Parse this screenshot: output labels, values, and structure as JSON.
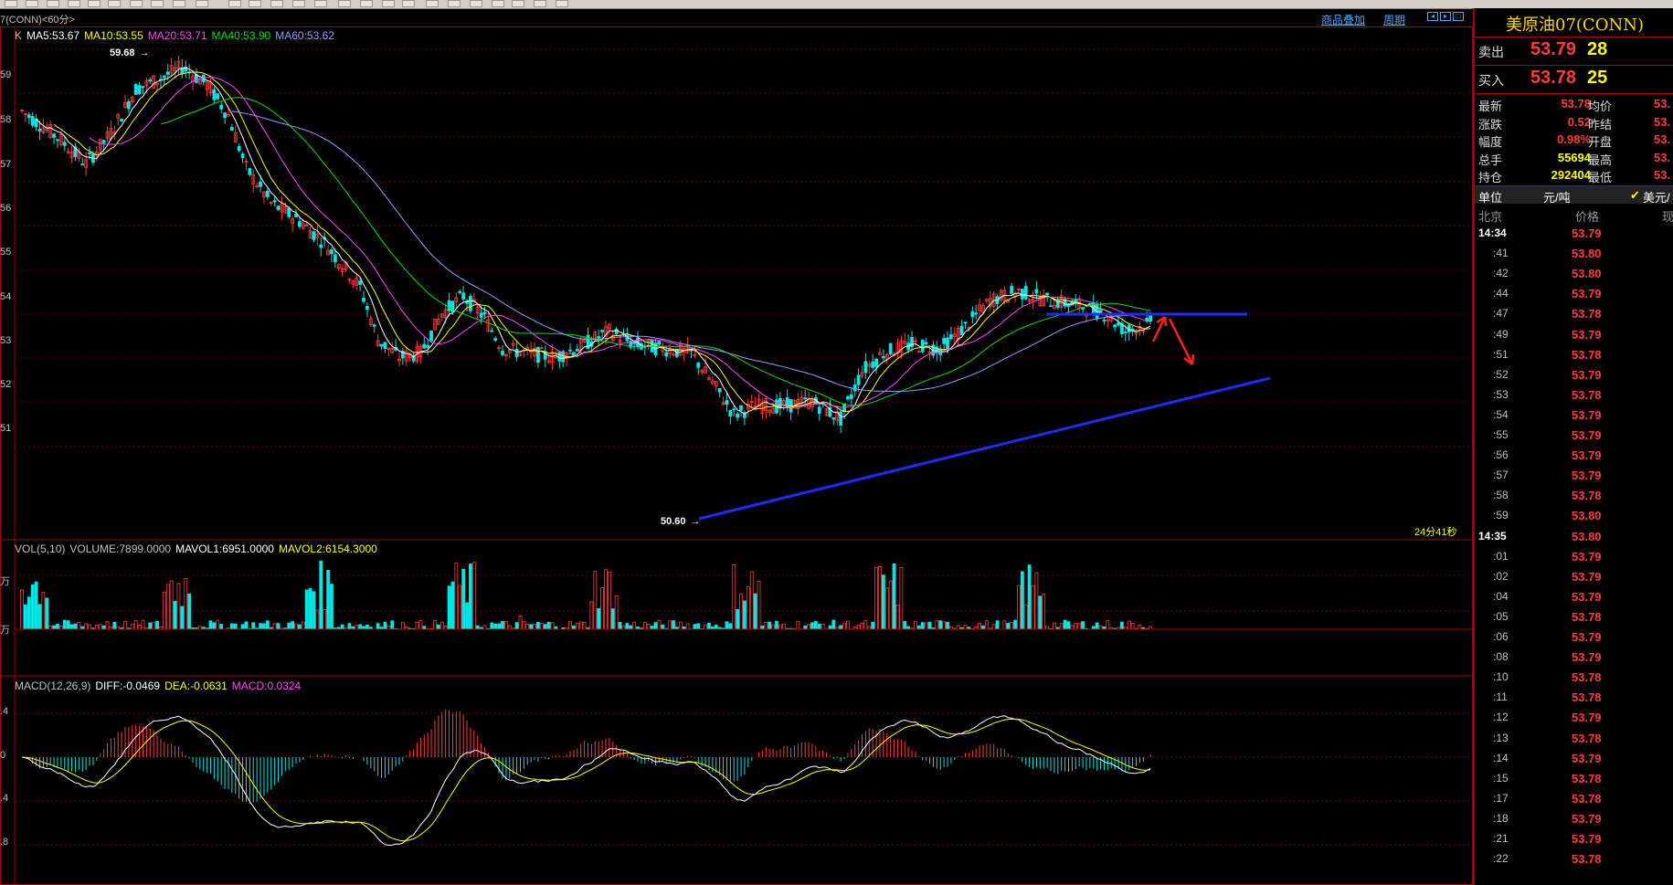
{
  "header": {
    "title": "7(CONN)<60分>",
    "links": [
      "商品叠加",
      "周期"
    ],
    "countdown": "24分41秒"
  },
  "kline": {
    "legend": [
      {
        "text": "K",
        "color": "#c0c0c0"
      },
      {
        "text": "MA5:53.67",
        "color": "#ffffff"
      },
      {
        "text": "MA10:53.55",
        "color": "#ffff00"
      },
      {
        "text": "MA20:53.71",
        "color": "#ff44ff"
      },
      {
        "text": "MA40:53.90",
        "color": "#00e000"
      },
      {
        "text": "MA60:53.62",
        "color": "#9a9aff"
      }
    ],
    "ylabels": [
      "59",
      "58",
      "57",
      "56",
      "55",
      "54",
      "53",
      "52",
      "51"
    ],
    "high_label": "59.68",
    "low_label": "50.60"
  },
  "volume": {
    "legend": [
      {
        "text": "VOL(5,10)",
        "color": "#c0c0c0"
      },
      {
        "text": "VOLUME:7899.0000",
        "color": "#c0c0c0"
      },
      {
        "text": "MAVOL1:6951.0000",
        "color": "#ffffff"
      },
      {
        "text": "MAVOL2:6154.3000",
        "color": "#ffff00"
      }
    ],
    "ylabels": [
      "万",
      "万"
    ]
  },
  "macd": {
    "legend": [
      {
        "text": "MACD(12,26,9)",
        "color": "#c0c0c0"
      },
      {
        "text": "DIFF:-0.0469",
        "color": "#ffffff"
      },
      {
        "text": "DEA:-0.0631",
        "color": "#ffff00"
      },
      {
        "text": "MACD:0.0324",
        "color": "#ff44ff"
      }
    ],
    "ylabels": [
      ".4",
      "0",
      ".4",
      ".8"
    ]
  },
  "quote": {
    "title": "美原油07(CONN)",
    "sell_label": "卖出",
    "sell_price": "53.79",
    "sell_qty": "28",
    "buy_label": "买入",
    "buy_price": "53.78",
    "buy_qty": "25",
    "stats": [
      {
        "l1": "最新",
        "v1": "53.78",
        "c1": "#ff3b3b",
        "l2": "均价",
        "v2": "53."
      },
      {
        "l1": "涨跌",
        "v1": "0.52",
        "c1": "#ff3b3b",
        "l2": "昨结",
        "v2": "53."
      },
      {
        "l1": "幅度",
        "v1": "0.98%",
        "c1": "#ff3b3b",
        "l2": "开盘",
        "v2": "53."
      },
      {
        "l1": "总手",
        "v1": "55694",
        "c1": "#ffff00",
        "l2": "最高",
        "v2": "53."
      },
      {
        "l1": "持仓",
        "v1": "292404",
        "c1": "#ffff00",
        "l2": "最低",
        "v2": "53."
      }
    ],
    "unit_label": "单位",
    "unit_value": "元/吨",
    "currency": "美元/",
    "col_time": "北京",
    "col_price": "价格",
    "col_qty": "现",
    "ticks": [
      {
        "t": "14:34",
        "p": "53.79",
        "bold": true
      },
      {
        "t": ":41",
        "p": "53.80"
      },
      {
        "t": ":42",
        "p": "53.80"
      },
      {
        "t": ":44",
        "p": "53.79"
      },
      {
        "t": ":47",
        "p": "53.78"
      },
      {
        "t": ":49",
        "p": "53.79"
      },
      {
        "t": ":51",
        "p": "53.78"
      },
      {
        "t": ":52",
        "p": "53.79"
      },
      {
        "t": ":53",
        "p": "53.78"
      },
      {
        "t": ":54",
        "p": "53.79"
      },
      {
        "t": ":55",
        "p": "53.79"
      },
      {
        "t": ":56",
        "p": "53.79"
      },
      {
        "t": ":57",
        "p": "53.79"
      },
      {
        "t": ":58",
        "p": "53.78"
      },
      {
        "t": ":59",
        "p": "53.80"
      },
      {
        "t": "14:35",
        "p": "53.80",
        "bold": true
      },
      {
        "t": ":01",
        "p": "53.79"
      },
      {
        "t": ":02",
        "p": "53.79"
      },
      {
        "t": ":04",
        "p": "53.79"
      },
      {
        "t": ":05",
        "p": "53.78"
      },
      {
        "t": ":06",
        "p": "53.79"
      },
      {
        "t": ":08",
        "p": "53.79"
      },
      {
        "t": ":10",
        "p": "53.78"
      },
      {
        "t": ":11",
        "p": "53.78"
      },
      {
        "t": ":12",
        "p": "53.79"
      },
      {
        "t": ":13",
        "p": "53.78"
      },
      {
        "t": ":14",
        "p": "53.79"
      },
      {
        "t": ":15",
        "p": "53.78"
      },
      {
        "t": ":17",
        "p": "53.78"
      },
      {
        "t": ":18",
        "p": "53.79"
      },
      {
        "t": ":21",
        "p": "53.79"
      },
      {
        "t": ":22",
        "p": "53.78"
      }
    ]
  }
}
